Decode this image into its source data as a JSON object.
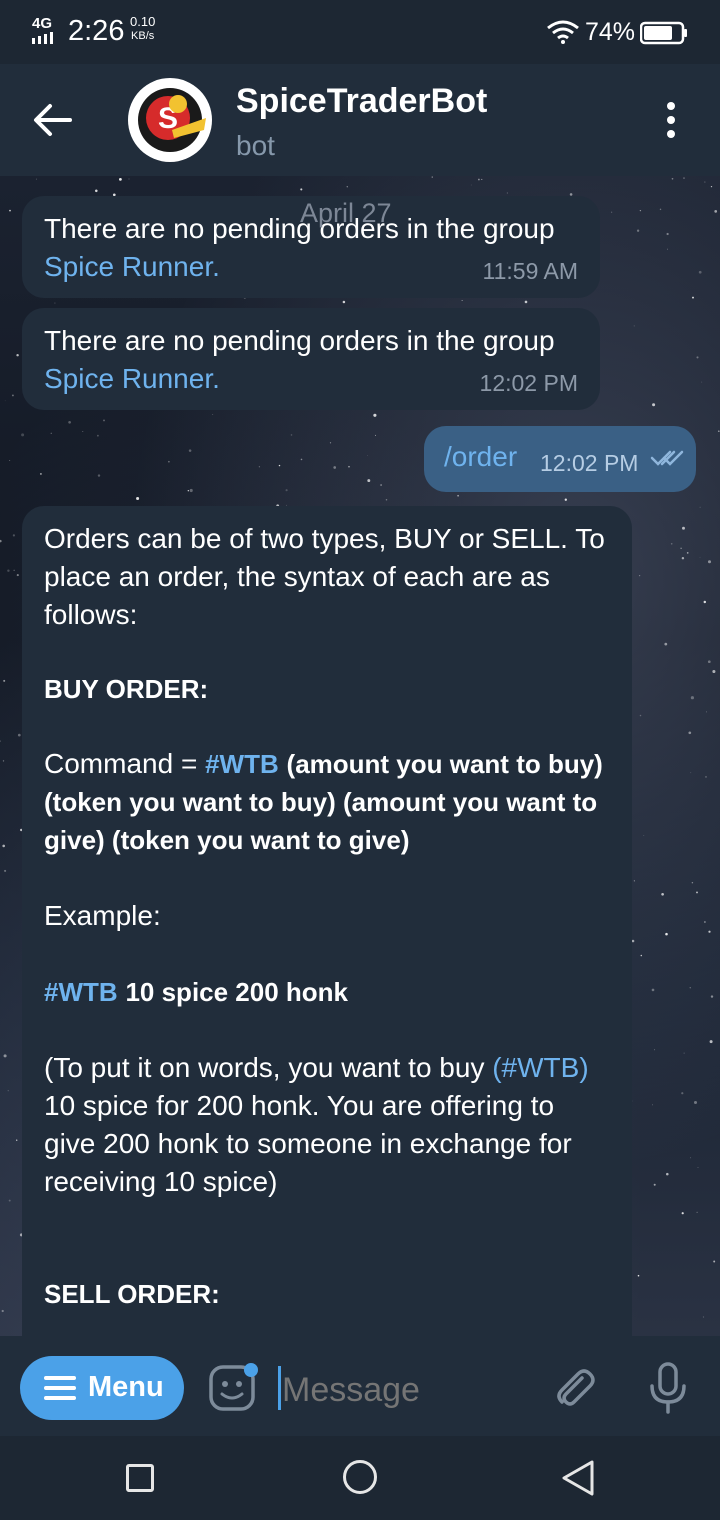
{
  "status_bar": {
    "network": "4G",
    "time": "2:26",
    "speed_value": "0.10",
    "speed_unit": "KB/s",
    "battery": "74%"
  },
  "header": {
    "title": "SpiceTraderBot",
    "subtitle": "bot",
    "avatar_icon": "spicetrader-logo",
    "back_icon": "back-arrow-icon",
    "more_icon": "more-vertical-icon"
  },
  "chat": {
    "date_label": "April 27",
    "messages": [
      {
        "text": "There are no pending orders in the group",
        "link": "Spice Runner.",
        "time": "11:59 AM"
      },
      {
        "text": "There are no pending orders in the group",
        "link": "Spice Runner.",
        "time": "12:02 PM"
      }
    ],
    "outgoing": {
      "text": "/order",
      "time": "12:02 PM",
      "status": "read"
    },
    "bot_reply": {
      "intro": "Orders can be of two types, BUY or SELL. To place an order, the syntax of each are as follows:",
      "buy_heading": "BUY ORDER:",
      "command_label": "Command =",
      "command_tag": "#WTB",
      "command_syntax": "(amount you want to buy) (token you want to buy) (amount you want to give) (token you want to give)",
      "example_label": "Example:",
      "example_tag": "#WTB",
      "example_body": "10 spice 200 honk",
      "explain_pre": "(To put it on words, you want to buy",
      "explain_tag": "(#WTB)",
      "explain_post": "10 spice for 200 honk. You are offering to give 200 honk to someone in exchange for receiving 10 spice)",
      "sell_heading": "SELL ORDER:"
    }
  },
  "input_bar": {
    "menu_label": "Menu",
    "placeholder": "Message",
    "accent": "#4ba1e8"
  },
  "colors": {
    "bubble": "#212d3b",
    "outgoing_bubble": "#3a6085",
    "link": "#6fb3ee"
  }
}
